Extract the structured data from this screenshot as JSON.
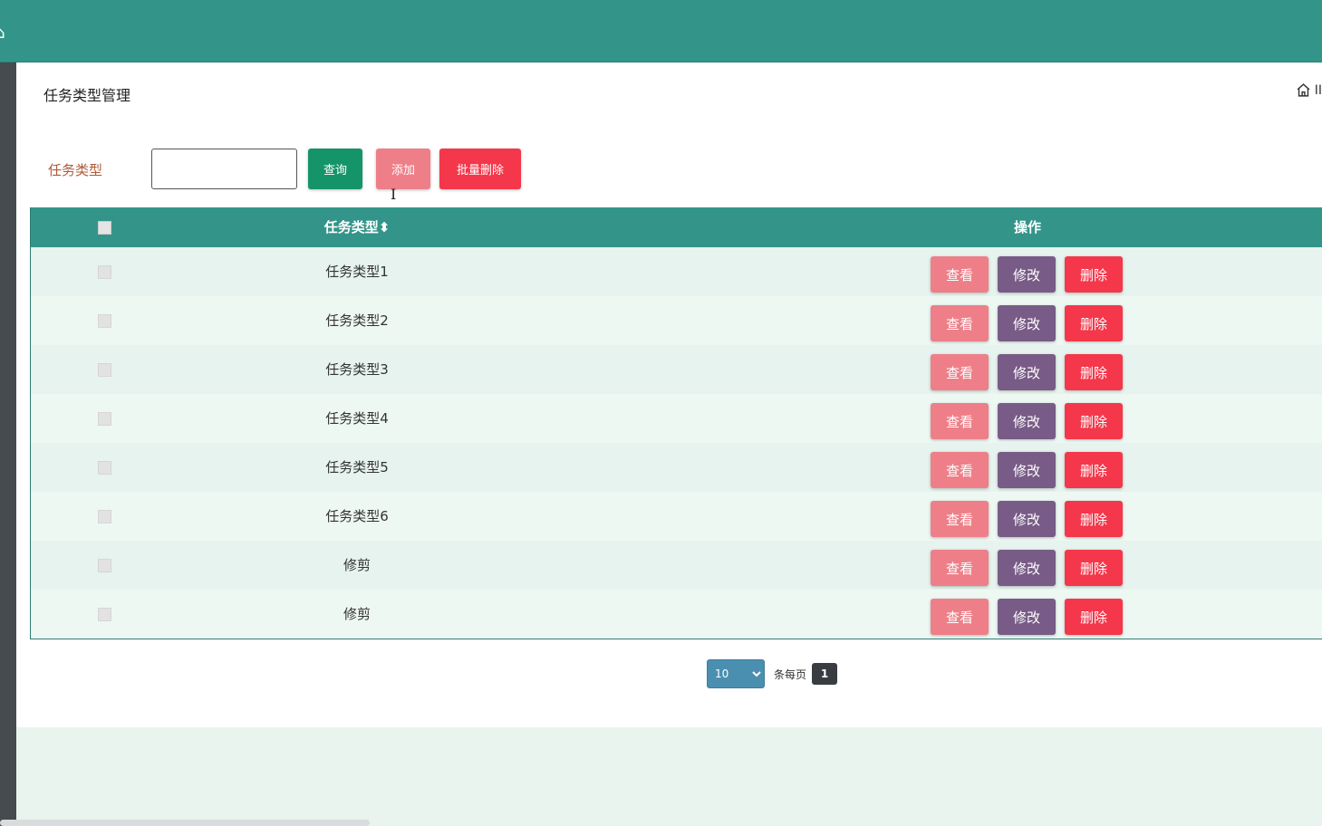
{
  "header": {
    "home_glyph": "⌂"
  },
  "page": {
    "title": "任务类型管理",
    "breadcrumb_text": "II"
  },
  "search": {
    "label": "任务类型",
    "input_value": "",
    "query_label": "查询",
    "add_label": "添加",
    "batch_delete_label": "批量删除"
  },
  "table": {
    "columns": {
      "type": "任务类型",
      "sort_glyph": "⬍",
      "operation": "操作"
    },
    "rows": [
      {
        "type": "任务类型1"
      },
      {
        "type": "任务类型2"
      },
      {
        "type": "任务类型3"
      },
      {
        "type": "任务类型4"
      },
      {
        "type": "任务类型5"
      },
      {
        "type": "任务类型6"
      },
      {
        "type": "修剪"
      },
      {
        "type": "修剪"
      }
    ],
    "actions": {
      "view": "查看",
      "edit": "修改",
      "delete": "删除"
    }
  },
  "pagination": {
    "page_size": "10",
    "per_page_label": "条每页",
    "current_page": "1"
  },
  "colors": {
    "header": "#33958a",
    "view": "#ee7f88",
    "edit": "#785b86",
    "delete": "#f4374a",
    "query": "#15946a"
  },
  "icons": {
    "breadcrumb": "home-icon"
  }
}
